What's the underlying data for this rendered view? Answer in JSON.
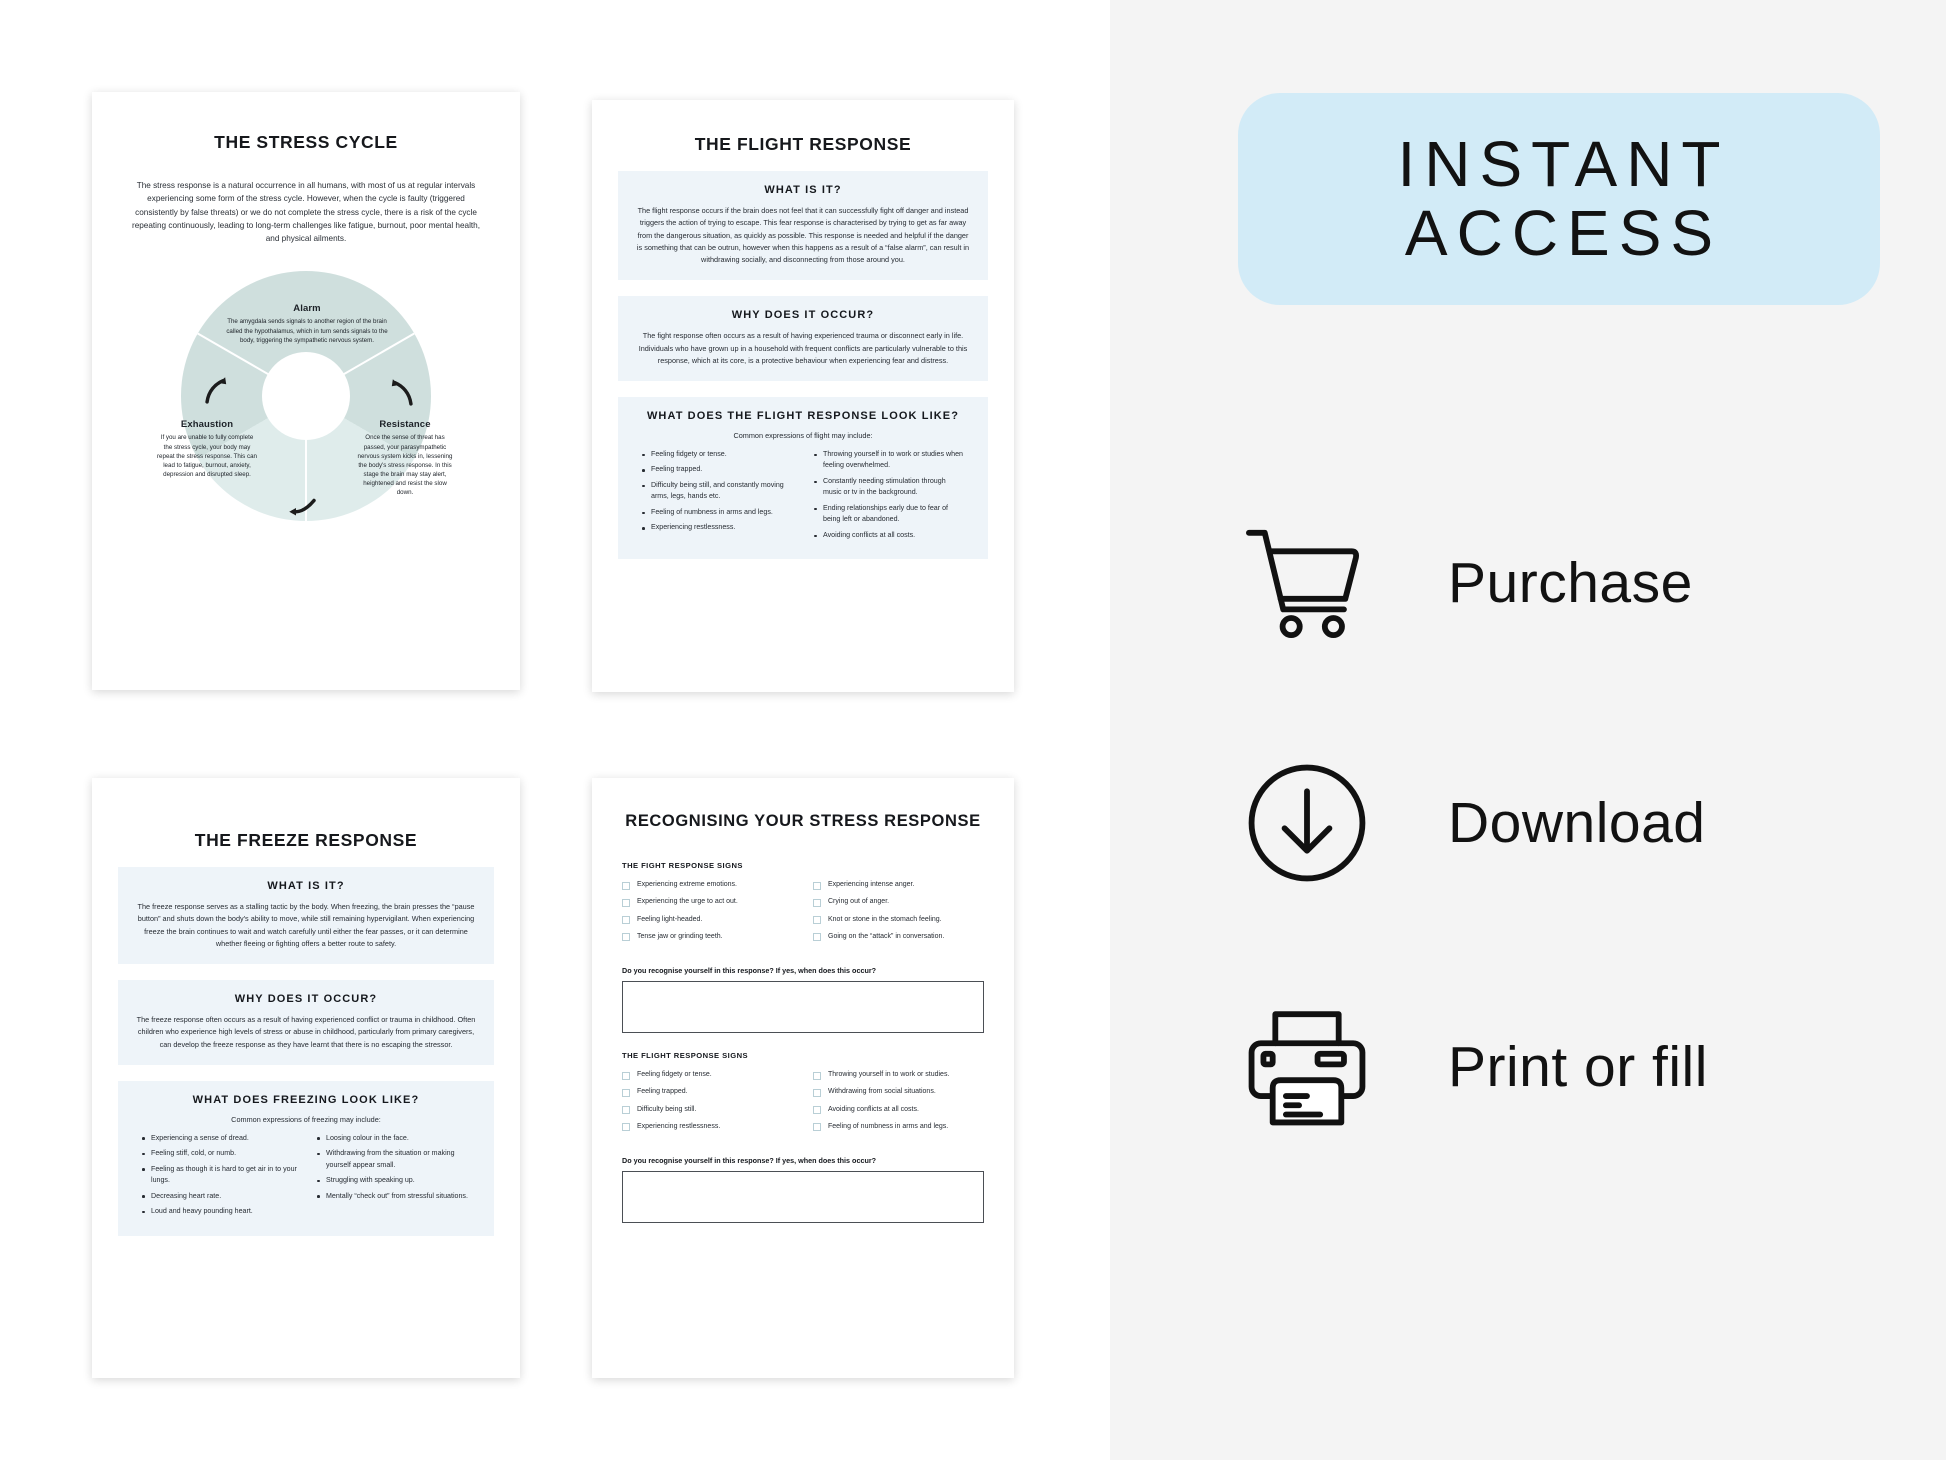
{
  "gallery": {
    "stress_cycle": {
      "title": "THE STRESS CYCLE",
      "intro": "The stress response is a natural occurrence in all humans, with most of us at regular intervals experiencing some form of the stress cycle. However, when the cycle is faulty (triggered consistently by false threats) or we do not complete the stress cycle, there is a risk of the cycle repeating continuously, leading to long-term challenges like fatigue, burnout, poor mental health, and physical ailments.",
      "segments": [
        {
          "name": "Alarm",
          "text": "The amygdala sends signals to another region of the brain called the hypothalamus, which in turn sends signals to the body, triggering the sympathetic nervous system."
        },
        {
          "name": "Resistance",
          "text": "Once the sense of threat has passed, your parasympathetic nervous system kicks in, lessening the body's stress response. In this stage the brain may stay alert, heightened and resist the slow down."
        },
        {
          "name": "Exhaustion",
          "text": "If you are unable to fully complete the stress cycle, your body may repeat the stress response. This can lead to fatigue, burnout, anxiety, depression and disrupted sleep."
        }
      ],
      "colors": {
        "segment_dark": "#cfdfdd",
        "segment_light": "#dfeceb"
      }
    },
    "flight_response": {
      "title": "THE FLIGHT RESPONSE",
      "cards": [
        {
          "title": "WHAT IS IT?",
          "body": "The flight response occurs if the brain does not feel that it can successfully fight off danger and instead triggers the action of trying to escape. This fear response is characterised by trying to get as far away from the dangerous situation, as quickly as possible. This response is needed and helpful if the danger is something that can be outrun, however when this happens as a result of a “false alarm”, can result in withdrawing socially, and disconnecting from those around you."
        },
        {
          "title": "WHY DOES IT OCCUR?",
          "body": "The fight response often occurs as a result of having experienced trauma or disconnect early in life. Individuals who have grown up in a household with frequent conflicts are particularly vulnerable to this response, which at its core, is a protective behaviour when experiencing fear and distress."
        }
      ],
      "signs_card": {
        "title": "WHAT DOES THE FLIGHT RESPONSE LOOK LIKE?",
        "subtitle": "Common expressions of flight may include:",
        "left_items": [
          "Feeling fidgety or tense.",
          "Feeling trapped.",
          "Difficulty being still, and constantly moving arms, legs, hands etc.",
          "Feeling of numbness in arms and legs.",
          "Experiencing restlessness."
        ],
        "right_items": [
          "Throwing yourself in to work or studies when feeling overwhelmed.",
          "Constantly needing stimulation through music or tv in the background.",
          "Ending relationships early due to fear of being left or abandoned.",
          "Avoiding conflicts at all costs."
        ]
      }
    },
    "freeze_response": {
      "title": "THE FREEZE RESPONSE",
      "cards": [
        {
          "title": "WHAT IS IT?",
          "body": "The freeze response serves as a stalling tactic by the body. When freezing, the brain presses the “pause button” and shuts down the body's ability to move, while still remaining hypervigilant. When experiencing freeze the brain continues to wait and watch carefully until either the fear passes, or it can determine whether fleeing or fighting offers a better route to safety."
        },
        {
          "title": "WHY DOES IT OCCUR?",
          "body": "The freeze response often occurs as a result of having experienced conflict or trauma in childhood. Often children who experience high levels of stress or abuse in childhood, particularly from primary caregivers, can develop the freeze response as they have learnt that there is no escaping the stressor."
        }
      ],
      "signs_card": {
        "title": "WHAT DOES FREEZING LOOK LIKE?",
        "subtitle": "Common expressions of freezing may include:",
        "left_items": [
          "Experiencing a sense of dread.",
          "Feeling stiff, cold, or numb.",
          "Feeling as though it is hard to get air in to your lungs.",
          "Decreasing heart rate.",
          "Loud and heavy pounding heart."
        ],
        "right_items": [
          "Loosing colour in the face.",
          "Withdrawing from the situation or making yourself appear small.",
          "Struggling with speaking up.",
          "Mentally “check out” from stressful situations."
        ]
      }
    },
    "worksheet": {
      "title": "RECOGNISING YOUR STRESS RESPONSE",
      "sections": [
        {
          "heading": "THE FIGHT RESPONSE SIGNS",
          "left_items": [
            "Experiencing extreme emotions.",
            "Experiencing the urge to act out.",
            "Feeling light-headed.",
            "Tense jaw or grinding teeth."
          ],
          "right_items": [
            "Experiencing intense anger.",
            "Crying out of anger.",
            "Knot or stone in the stomach feeling.",
            "Going on the “attack” in conversation."
          ],
          "question": "Do you recognise yourself in this response? If yes, when does this occur?",
          "answer": ""
        },
        {
          "heading": "THE FLIGHT RESPONSE SIGNS",
          "left_items": [
            "Feeling fidgety or tense.",
            "Feeling trapped.",
            "Difficulty being still.",
            "Experiencing restlessness."
          ],
          "right_items": [
            "Throwing yourself in to work or studies.",
            "Withdrawing from social situations.",
            "Avoiding conflicts at all costs.",
            "Feeling of numbness in arms and legs."
          ],
          "question": "Do you recognise yourself in this response? If yes, when does this occur?",
          "answer": ""
        }
      ]
    }
  },
  "promo": {
    "banner": {
      "line1": "INSTANT",
      "line2": "ACCESS",
      "background_color": "#d2ebf7"
    },
    "features": [
      {
        "icon": "shopping-cart-icon",
        "label": "Purchase"
      },
      {
        "icon": "download-circle-icon",
        "label": "Download"
      },
      {
        "icon": "printer-icon",
        "label": "Print or fill"
      }
    ],
    "panel_background": "#f4f4f4"
  }
}
